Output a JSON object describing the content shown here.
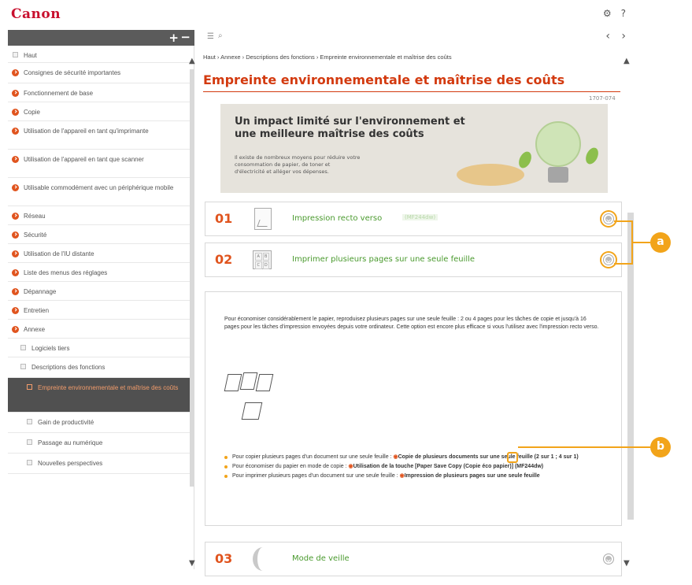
{
  "header": {
    "logo": "Canon",
    "settings_icon": "⚙",
    "help_icon": "?"
  },
  "sidebar_toolbar": {
    "expand_label": "+",
    "collapse_label": "−"
  },
  "sidebar": {
    "items": [
      {
        "label": "Haut",
        "kind": "square"
      },
      {
        "label": "Consignes de sécurité importantes",
        "kind": "dot"
      },
      {
        "label": "Fonctionnement de base",
        "kind": "dot"
      },
      {
        "label": "Copie",
        "kind": "dot"
      },
      {
        "label": "Utilisation de l'appareil en tant qu'imprimante",
        "kind": "dot"
      },
      {
        "label": "Utilisation de l'appareil en tant que scanner",
        "kind": "dot"
      },
      {
        "label": "Utilisable commodément avec un périphérique mobile",
        "kind": "dot"
      },
      {
        "label": "Réseau",
        "kind": "dot"
      },
      {
        "label": "Sécurité",
        "kind": "dot"
      },
      {
        "label": "Utilisation de l'IU distante",
        "kind": "dot"
      },
      {
        "label": "Liste des menus des réglages",
        "kind": "dot"
      },
      {
        "label": "Dépannage",
        "kind": "dot"
      },
      {
        "label": "Entretien",
        "kind": "dot"
      },
      {
        "label": "Annexe",
        "kind": "dot"
      },
      {
        "label": "Logiciels tiers",
        "kind": "sub"
      },
      {
        "label": "Descriptions des fonctions",
        "kind": "sub"
      },
      {
        "label": "Empreinte environnementale et maîtrise des coûts",
        "kind": "active"
      },
      {
        "label": "Gain de productivité",
        "kind": "sub2"
      },
      {
        "label": "Passage au numérique",
        "kind": "sub2"
      },
      {
        "label": "Nouvelles perspectives",
        "kind": "sub2"
      }
    ]
  },
  "main": {
    "breadcrumb": "Haut › Annexe › Descriptions des fonctions › Empreinte environnementale et maîtrise des coûts",
    "title": "Empreinte environnementale et maîtrise des coûts",
    "doc_code": "1707-074",
    "banner": {
      "title": "Un impact limité sur l'environnement et une meilleure maîtrise des coûts",
      "text": "Il existe de nombreux moyens pour réduire votre consommation de papier, de toner et d'électricité et alléger vos dépenses."
    },
    "sections": [
      {
        "num": "01",
        "label": "Impression recto verso",
        "model": "(MF244dw)"
      },
      {
        "num": "02",
        "label": "Imprimer plusieurs pages sur une seule feuille",
        "grid": [
          "A",
          "B",
          "C",
          "D"
        ]
      },
      {
        "num": "03",
        "label": "Mode de veille"
      }
    ],
    "panel": {
      "text": "Pour économiser considérablement le papier, reproduisez plusieurs pages sur une seule feuille : 2 ou 4 pages pour les tâches de copie et jusqu'à 16 pages pour les tâches d'impression envoyées depuis votre ordinateur. Cette option est encore plus efficace si vous l'utilisez avec l'impression recto verso.",
      "bullets": [
        {
          "prefix": "Pour copier plusieurs pages d'un document sur une seule feuille : ",
          "link": "Copie de plusieurs documents sur une seule feuille (2 sur 1 ; 4 sur 1)"
        },
        {
          "prefix": "Pour économiser du papier en mode de copie : ",
          "link": "Utilisation de la touche [Paper Save Copy (Copie éco papier)] (MF244dw)"
        },
        {
          "prefix": "Pour imprimer plusieurs pages d'un document sur une seule feuille : ",
          "link": "Impression de plusieurs pages sur une seule feuille"
        }
      ]
    }
  },
  "callouts": {
    "a": "a",
    "b": "b"
  },
  "colors": {
    "accent": "#e0541e",
    "title": "#d33a0f",
    "link_green": "#4a9a2e",
    "callout": "#f2a41a",
    "sidebar_active": "#505050"
  }
}
